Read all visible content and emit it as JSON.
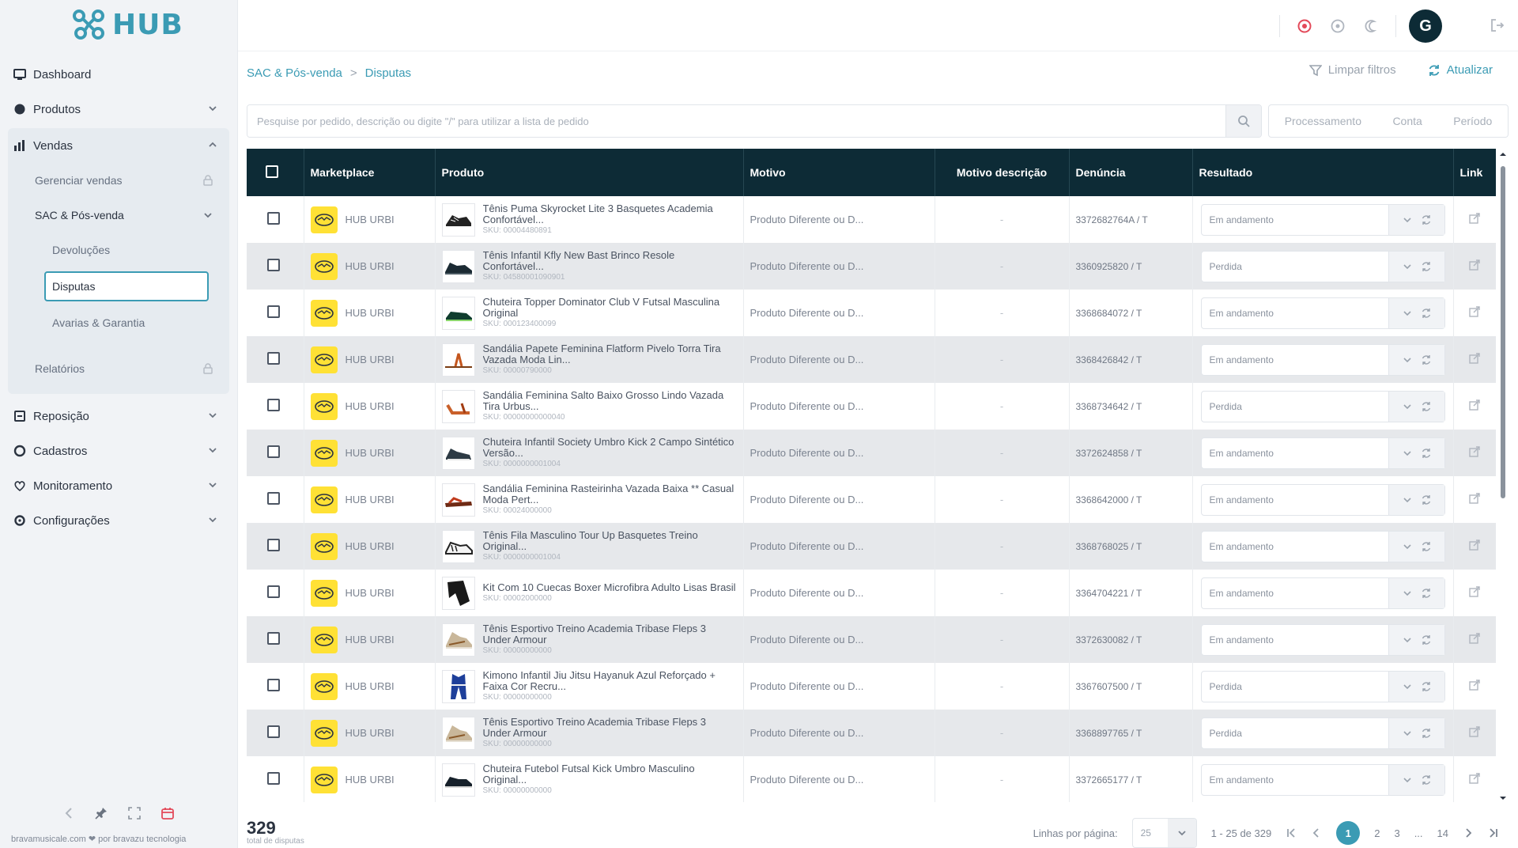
{
  "brand": {
    "name": "HUB"
  },
  "sidebar": {
    "items": [
      {
        "label": "Dashboard",
        "icon": "dashboard-icon"
      },
      {
        "label": "Produtos",
        "icon": "box-icon",
        "expandable": true
      },
      {
        "label": "Vendas",
        "icon": "sales-icon",
        "expandable": true,
        "expanded": true
      },
      {
        "label": "Reposição",
        "icon": "restock-icon",
        "expandable": true
      },
      {
        "label": "Cadastros",
        "icon": "register-icon",
        "expandable": true
      },
      {
        "label": "Monitoramento",
        "icon": "monitor-icon",
        "expandable": true
      },
      {
        "label": "Configurações",
        "icon": "gear-icon",
        "expandable": true
      }
    ],
    "vendas_sub": {
      "gerenciar": "Gerenciar vendas",
      "sac": "SAC & Pós-venda",
      "devolucoes": "Devoluções",
      "disputas": "Disputas",
      "avarias": "Avarias & Garantia",
      "relatorios": "Relatórios"
    },
    "footer": "bravamusicale.com ❤ por bravazu tecnologia"
  },
  "breadcrumb": {
    "parent": "SAC & Pós-venda",
    "separator": ">",
    "current": "Disputas"
  },
  "actions": {
    "clear_filters": "Limpar filtros",
    "refresh": "Atualizar"
  },
  "search": {
    "placeholder": "Pesquise por pedido, descrição ou digite \"/\" para utilizar a lista de pedido",
    "value": ""
  },
  "filter_tabs": [
    "Processamento",
    "Conta",
    "Período"
  ],
  "table": {
    "headers": [
      "Marketplace",
      "Produto",
      "Motivo",
      "Motivo descrição",
      "Denúncia",
      "Resultado",
      "Link"
    ],
    "rows": [
      {
        "marketplace": "HUB URBI",
        "product": "Tênis Puma Skyrocket Lite 3 Basquetes Academia Confortável...",
        "sku": "SKU: 00004480891",
        "motivo": "Produto Diferente ou D...",
        "motivo_desc": "-",
        "denuncia": "3372682764A / T",
        "resultado": "Em andamento",
        "thumb": "sneaker-black"
      },
      {
        "marketplace": "HUB URBI",
        "product": "Tênis Infantil Kfly New Bast Brinco Resole Confortável...",
        "sku": "SKU: 04580001090901",
        "motivo": "Produto Diferente ou D...",
        "motivo_desc": "-",
        "denuncia": "3360925820 / T",
        "resultado": "Perdida",
        "thumb": "sneaker-dark"
      },
      {
        "marketplace": "HUB URBI",
        "product": "Chuteira Topper Dominator Club V Futsal Masculina Original",
        "sku": "SKU: 000123400099",
        "motivo": "Produto Diferente ou D...",
        "motivo_desc": "-",
        "denuncia": "3368684072 / T",
        "resultado": "Em andamento",
        "thumb": "shoe-green"
      },
      {
        "marketplace": "HUB URBI",
        "product": "Sandália Papete Feminina Flatform Pivelo Torra Tira Vazada Moda Lin...",
        "sku": "SKU: 00000790000",
        "motivo": "Produto Diferente ou D...",
        "motivo_desc": "-",
        "denuncia": "3368426842 / T",
        "resultado": "Em andamento",
        "thumb": "sandal-brown"
      },
      {
        "marketplace": "HUB URBI",
        "product": "Sandália Feminina Salto Baixo Grosso Lindo Vazada Tira Urbus...",
        "sku": "SKU: 00000000000040",
        "motivo": "Produto Diferente ou D...",
        "motivo_desc": "-",
        "denuncia": "3368734642 / T",
        "resultado": "Perdida",
        "thumb": "sandal-orange"
      },
      {
        "marketplace": "HUB URBI",
        "product": "Chuteira Infantil Society Umbro Kick 2 Campo Sintético Versão...",
        "sku": "SKU: 0000000001004",
        "motivo": "Produto Diferente ou D...",
        "motivo_desc": "-",
        "denuncia": "3372624858 / T",
        "resultado": "Em andamento",
        "thumb": "boot-mixed"
      },
      {
        "marketplace": "HUB URBI",
        "product": "Sandália Feminina Rasteirinha Vazada Baixa ** Casual Moda Pert...",
        "sku": "SKU: 00024000000",
        "motivo": "Produto Diferente ou D...",
        "motivo_desc": "-",
        "denuncia": "3368642000 / T",
        "resultado": "Em andamento",
        "thumb": "sandal-red"
      },
      {
        "marketplace": "HUB URBI",
        "product": "Tênis Fila Masculino Tour Up Basquetes Treino Original...",
        "sku": "SKU: 0000000001004",
        "motivo": "Produto Diferente ou D...",
        "motivo_desc": "-",
        "denuncia": "3368768025 / T",
        "resultado": "Em andamento",
        "thumb": "sneaker-white"
      },
      {
        "marketplace": "HUB URBI",
        "product": "Kit Com 10 Cuecas Boxer Microfibra Adulto Lisas Brasil",
        "sku": "SKU: 00002000000",
        "motivo": "Produto Diferente ou D...",
        "motivo_desc": "-",
        "denuncia": "3364704221 / T",
        "resultado": "Em andamento",
        "thumb": "underwear-black"
      },
      {
        "marketplace": "HUB URBI",
        "product": "Tênis Esportivo Treino Academia Tribase Fleps 3 Under Armour",
        "sku": "SKU: 00000000000",
        "motivo": "Produto Diferente ou D...",
        "motivo_desc": "-",
        "denuncia": "3372630082 / T",
        "resultado": "Em andamento",
        "thumb": "sneaker-tan"
      },
      {
        "marketplace": "HUB URBI",
        "product": "Kimono Infantil Jiu Jitsu Hayanuk Azul Reforçado + Faixa Cor Recru...",
        "sku": "SKU: 00000000000",
        "motivo": "Produto Diferente ou D...",
        "motivo_desc": "-",
        "denuncia": "3367607500 / T",
        "resultado": "Perdida",
        "thumb": "kimono-blue"
      },
      {
        "marketplace": "HUB URBI",
        "product": "Tênis Esportivo Treino Academia Tribase Fleps 3 Under Armour",
        "sku": "SKU: 00000000000",
        "motivo": "Produto Diferente ou D...",
        "motivo_desc": "-",
        "denuncia": "3368897765 / T",
        "resultado": "Perdida",
        "thumb": "sneaker-tan"
      },
      {
        "marketplace": "HUB URBI",
        "product": "Chuteira Futebol Futsal Kick Umbro Masculino Original...",
        "sku": "SKU: 00000000000",
        "motivo": "Produto Diferente ou D...",
        "motivo_desc": "-",
        "denuncia": "3372665177 / T",
        "resultado": "Em andamento",
        "thumb": "boot-black"
      }
    ]
  },
  "footer": {
    "total": "329",
    "total_label": "total de disputas",
    "rows_per_page_label": "Linhas por página:",
    "rows_per_page": "25",
    "range": "1 - 25 de 329",
    "pages": [
      "1",
      "2",
      "3",
      "...",
      "14"
    ],
    "active_page": "1"
  },
  "colors": {
    "accent": "#3b9bb4",
    "header_bg": "#0d2b36",
    "marketplace_yellow": "#ffe135",
    "lost": "#e34a5a"
  }
}
